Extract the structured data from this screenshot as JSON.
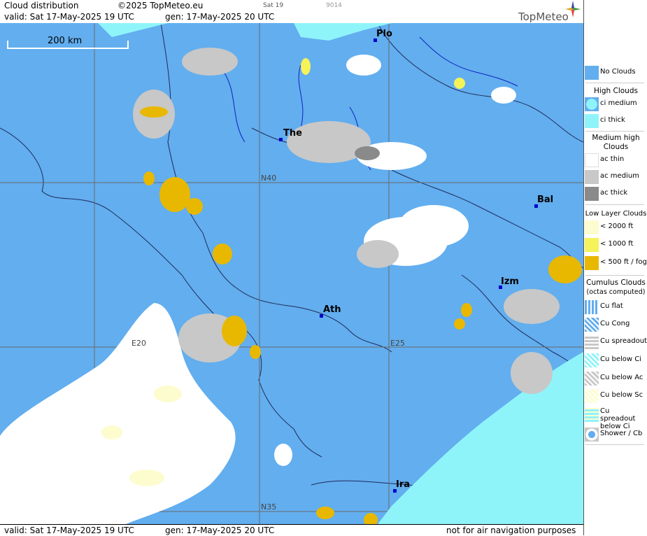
{
  "header": {
    "title": "Cloud distribution",
    "copyright": "©2025 TopMeteo.eu",
    "day_tab": "Sat 19",
    "code": "9014",
    "valid": "valid:  Sat  17-May-2025  19 UTC",
    "gen": "gen: 17-May-2025 20 UTC",
    "brand": "TopMeteo"
  },
  "footer": {
    "valid": "valid:  Sat  17-May-2025  19 UTC",
    "gen": "gen: 17-May-2025 20 UTC",
    "disclaimer": "not for air navigation purposes"
  },
  "map": {
    "scale_label": "200 km",
    "grid_labels": {
      "n40": "N40",
      "n35": "N35",
      "e20": "E20",
      "e25": "E25"
    },
    "cities": {
      "plo": "Plo",
      "the": "The",
      "bal": "Bal",
      "izm": "Izm",
      "ath": "Ath",
      "ira": "Ira"
    }
  },
  "legend": {
    "no_clouds": "No Clouds",
    "high_clouds": "High Clouds",
    "ci_medium": "ci medium",
    "ci_thick": "ci thick",
    "medium_high": "Medium high Clouds",
    "ac_thin": "ac thin",
    "ac_medium": "ac medium",
    "ac_thick": "ac thick",
    "low_layer": "Low Layer Clouds",
    "lt2000": "< 2000 ft",
    "lt1000": "< 1000 ft",
    "lt500": "< 500 ft / fog",
    "cumulus": "Cumulus Clouds",
    "octas": "(octas computed)",
    "cu_flat": "Cu flat",
    "cu_cong": "Cu Cong",
    "cu_spreadout": "Cu spreadout",
    "cu_below_ci": "Cu below Ci",
    "cu_below_ac": "Cu below Ac",
    "cu_below_sc": "Cu below Sc",
    "cu_spreadout_below_ci": "Cu spreadout below Ci",
    "shower_cb": "Shower / Cb"
  },
  "colors": {
    "sea_no_clouds": "#62aeef",
    "ci_thick": "#8ff4fa",
    "ac_thin": "#ffffff",
    "ac_medium": "#c8c8c8",
    "ac_thick": "#8a8a8a",
    "low_2000": "#fdfccf",
    "low_1000": "#f5f25a",
    "low_500": "#e8b800"
  }
}
